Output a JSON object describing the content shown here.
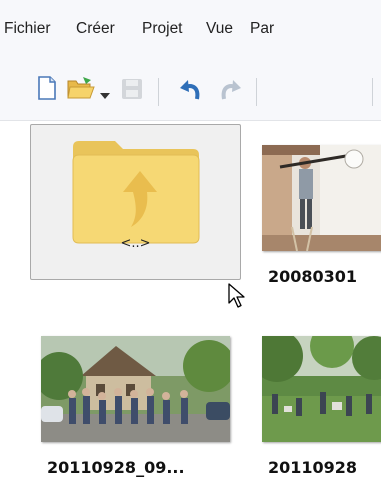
{
  "menu": {
    "items": [
      "Fichier",
      "Créer",
      "Projet",
      "Vue",
      "Par"
    ]
  },
  "toolbar": {
    "icons": [
      "new-document-icon",
      "open-folder-icon",
      "dropdown-arrow-icon",
      "save-icon",
      "undo-icon",
      "redo-icon"
    ]
  },
  "browser": {
    "parent_folder_label": "<..>",
    "thumbnails": [
      {
        "caption": "20080301"
      },
      {
        "caption": "20110928_09..."
      },
      {
        "caption": "20110928"
      }
    ]
  },
  "colors": {
    "folder": "#f6d874",
    "undo": "#2f6fb8",
    "redo": "#b9c3d0"
  }
}
